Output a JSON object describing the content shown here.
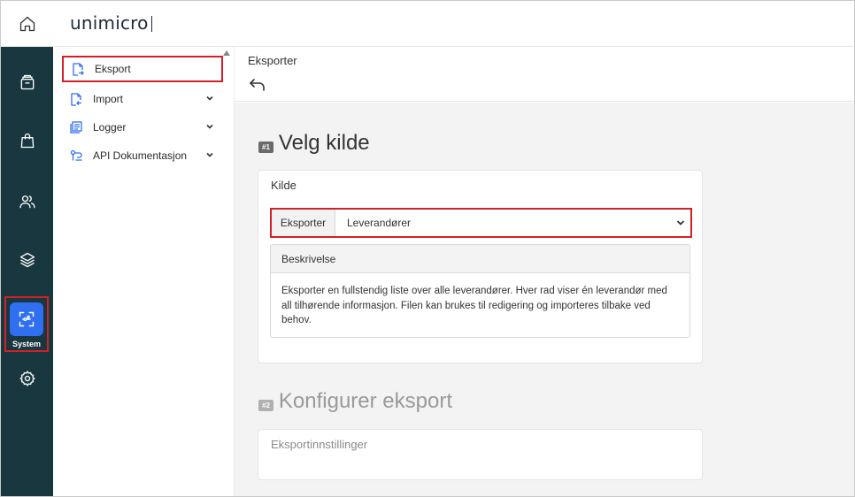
{
  "app": {
    "logo_text": "unimicro"
  },
  "rail": {
    "items": [
      {
        "name": "home",
        "icon": "home-icon"
      },
      {
        "name": "archive",
        "icon": "archive-box-icon"
      },
      {
        "name": "sales",
        "icon": "shopping-bag-icon"
      },
      {
        "name": "contacts",
        "icon": "users-icon"
      },
      {
        "name": "layers",
        "icon": "layers-icon"
      },
      {
        "name": "system",
        "icon": "system-icon",
        "label": "System",
        "active": true
      },
      {
        "name": "settings",
        "icon": "gear-icon"
      }
    ]
  },
  "subnav": {
    "items": [
      {
        "label": "Eksport",
        "icon": "file-export-icon",
        "active": true
      },
      {
        "label": "Import",
        "icon": "file-import-icon",
        "expandable": true
      },
      {
        "label": "Logger",
        "icon": "log-list-icon",
        "expandable": true
      },
      {
        "label": "API Dokumentasjon",
        "icon": "api-doc-icon",
        "expandable": true
      }
    ]
  },
  "page": {
    "title": "Eksporter",
    "back_icon": "back-arrow-icon"
  },
  "step1": {
    "badge": "#1",
    "heading": "Velg kilde",
    "card_title": "Kilde",
    "select_addon": "Eksporter",
    "select_value": "Leverandører",
    "desc_title": "Beskrivelse",
    "desc_text": "Eksporter en fullstendig liste over alle leverandører. Hver rad viser én leverandør med all tilhørende informasjon. Filen kan brukes til redigering og importeres tilbake ved behov."
  },
  "step2": {
    "badge": "#2",
    "heading": "Konfigurer eksport",
    "card_title": "Eksportinnstillinger"
  },
  "colors": {
    "rail_bg": "#18373f",
    "accent": "#2f6ff0",
    "highlight": "#d32027"
  }
}
